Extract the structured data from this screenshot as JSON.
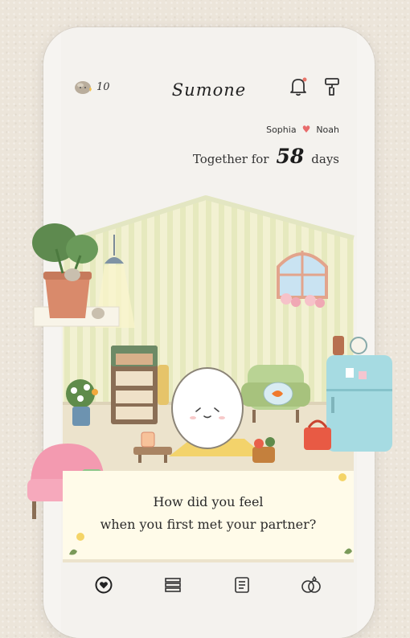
{
  "app": {
    "logo": "Sumone"
  },
  "header": {
    "gem_count": "10",
    "gem_icon": "pebble-gem-icon",
    "notification_dot_color": "#e8766a"
  },
  "couple": {
    "name_1": "Sophia",
    "name_2": "Noah",
    "heart_color": "#e86b6b"
  },
  "together": {
    "label": "Together for",
    "days": "58",
    "unit": "days"
  },
  "question": {
    "line_1": "How did you feel",
    "line_2": "when you first met your partner?"
  },
  "nav": {
    "items": [
      "home-heart-icon",
      "books-icon",
      "journal-icon",
      "rings-icon"
    ],
    "active_index": 0
  },
  "colors": {
    "wall": "#f1f0cf",
    "wall_stripe": "#e4e8bd",
    "floor": "#ece3cc",
    "card": "#fffbe9",
    "accent_pink": "#f39ab0"
  }
}
